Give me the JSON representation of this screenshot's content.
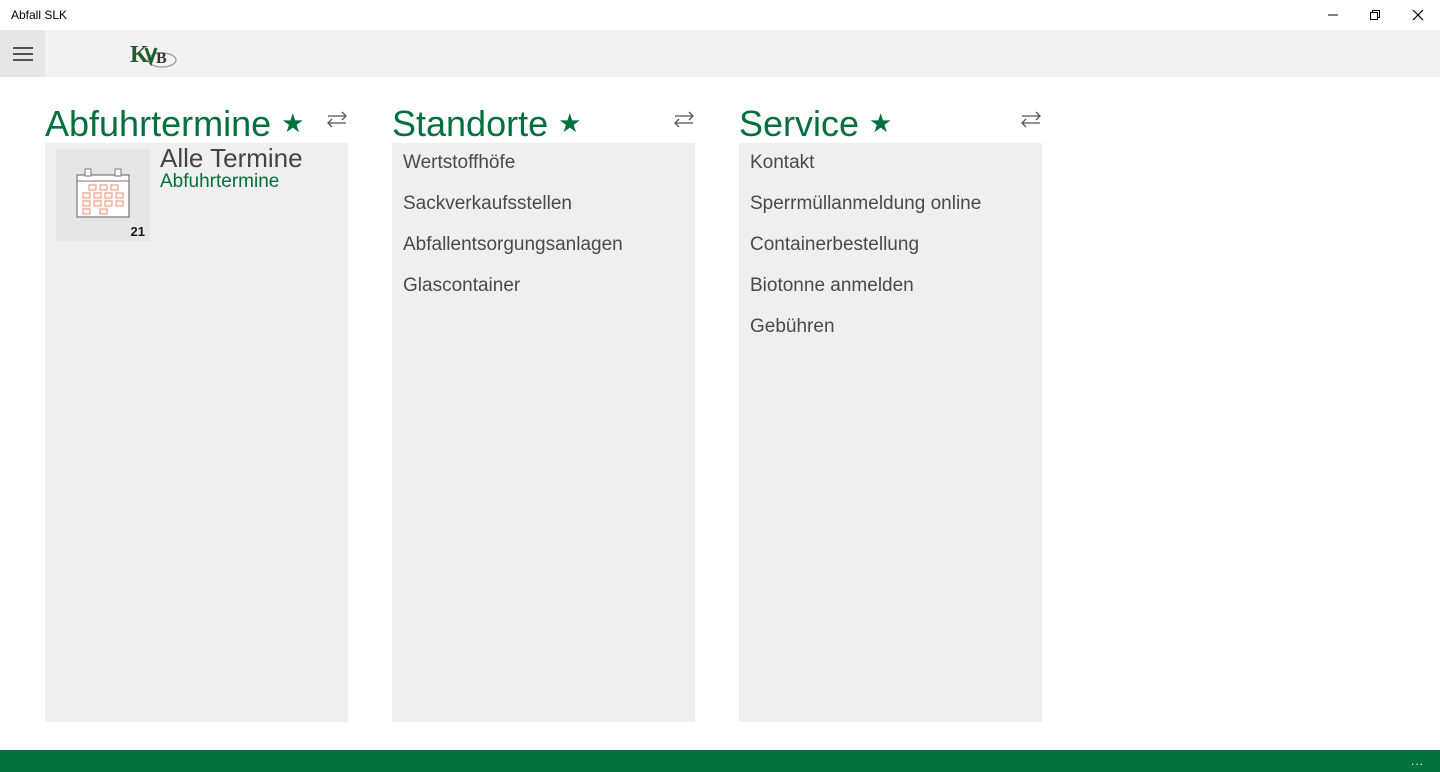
{
  "window": {
    "title": "Abfall SLK"
  },
  "logo": {
    "text": "KVB"
  },
  "columns": [
    {
      "title": "Abfuhrtermine",
      "tile": {
        "title": "Alle Termine",
        "subtitle": "Abfuhrtermine",
        "count": "21"
      }
    },
    {
      "title": "Standorte",
      "items": [
        "Wertstoffhöfe",
        "Sackverkaufsstellen",
        "Abfallentsorgungsanlagen",
        "Glascontainer"
      ]
    },
    {
      "title": "Service",
      "items": [
        "Kontakt",
        "Sperrmüllanmeldung online",
        "Containerbestellung",
        "Biotonne anmelden",
        "Gebühren"
      ]
    }
  ],
  "icons": {
    "star": "★",
    "more": "..."
  },
  "colors": {
    "accent": "#00703c",
    "panel": "#efefef",
    "header": "#f2f2f2",
    "calendar_orange": "#e8896a"
  }
}
